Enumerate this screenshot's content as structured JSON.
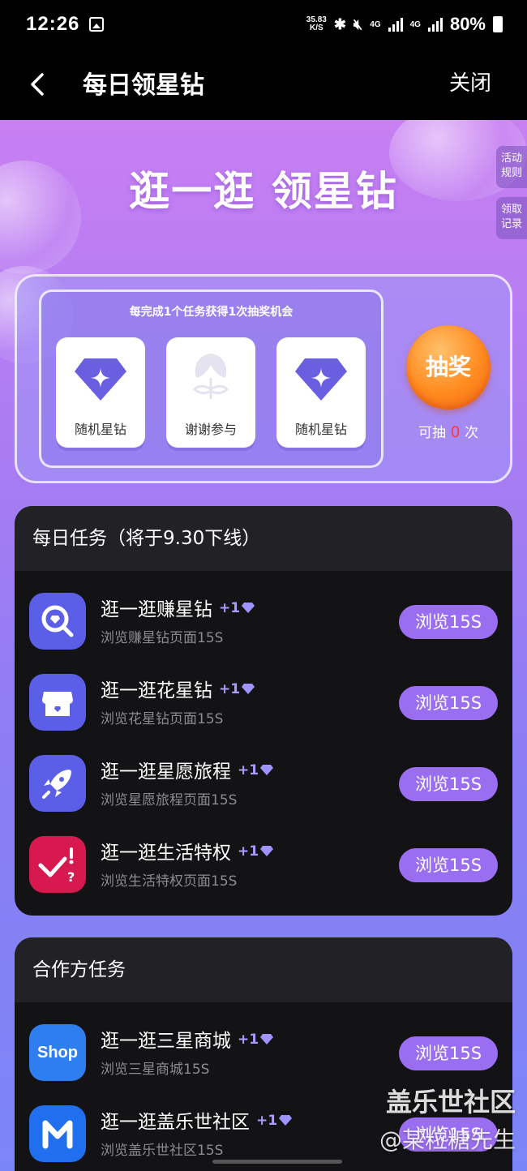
{
  "status_bar": {
    "time": "12:26",
    "net_speed_value": "35.83",
    "net_speed_unit": "K/S",
    "network_1": "4G",
    "network_2": "4G",
    "battery": "80%"
  },
  "nav": {
    "title": "每日领星钻",
    "close_label": "关闭"
  },
  "hero": {
    "title": "逛一逛 领星钻"
  },
  "side_tabs": {
    "rules": "活动规则",
    "records": "领取记录"
  },
  "lottery": {
    "hint": "每完成1个任务获得1次抽奖机会",
    "prizes": [
      {
        "label": "随机星钻",
        "icon": "diamond-icon"
      },
      {
        "label": "谢谢参与",
        "icon": "sprout-icon"
      },
      {
        "label": "随机星钻",
        "icon": "diamond-icon"
      }
    ],
    "draw_button": "抽奖",
    "count_prefix": "可抽",
    "count": "0",
    "count_suffix": "次"
  },
  "daily_tasks": {
    "header": "每日任务（将于9.30下线）",
    "tasks": [
      {
        "title": "逛一逛赚星钻",
        "reward": "+1",
        "subtitle": "浏览赚星钻页面15S",
        "button": "浏览15S",
        "icon": "search-icon",
        "icon_color": "#5b5ee6"
      },
      {
        "title": "逛一逛花星钻",
        "reward": "+1",
        "subtitle": "浏览花星钻页面15S",
        "button": "浏览15S",
        "icon": "store-icon",
        "icon_color": "#5b5ee6"
      },
      {
        "title": "逛一逛星愿旅程",
        "reward": "+1",
        "subtitle": "浏览星愿旅程页面15S",
        "button": "浏览15S",
        "icon": "rocket-icon",
        "icon_color": "#5b5ee6"
      },
      {
        "title": "逛一逛生活特权",
        "reward": "+1",
        "subtitle": "浏览生活特权页面15S",
        "button": "浏览15S",
        "icon": "check-question-icon",
        "icon_color": "#d8194f"
      }
    ]
  },
  "partner_tasks": {
    "header": "合作方任务",
    "tasks": [
      {
        "title": "逛一逛三星商城",
        "reward": "+1",
        "subtitle": "浏览三星商城15S",
        "button": "浏览15S",
        "icon": "shop-icon",
        "icon_text": "Shop",
        "icon_color": "#2f7ef0"
      },
      {
        "title": "逛一逛盖乐世社区",
        "reward": "+1",
        "subtitle": "浏览盖乐世社区15S",
        "button": "浏览15S",
        "icon": "members-icon",
        "icon_color": "#1f6fee"
      }
    ]
  },
  "watermark": {
    "line1": "盖乐世社区",
    "line2": "@某粒糖先生"
  }
}
